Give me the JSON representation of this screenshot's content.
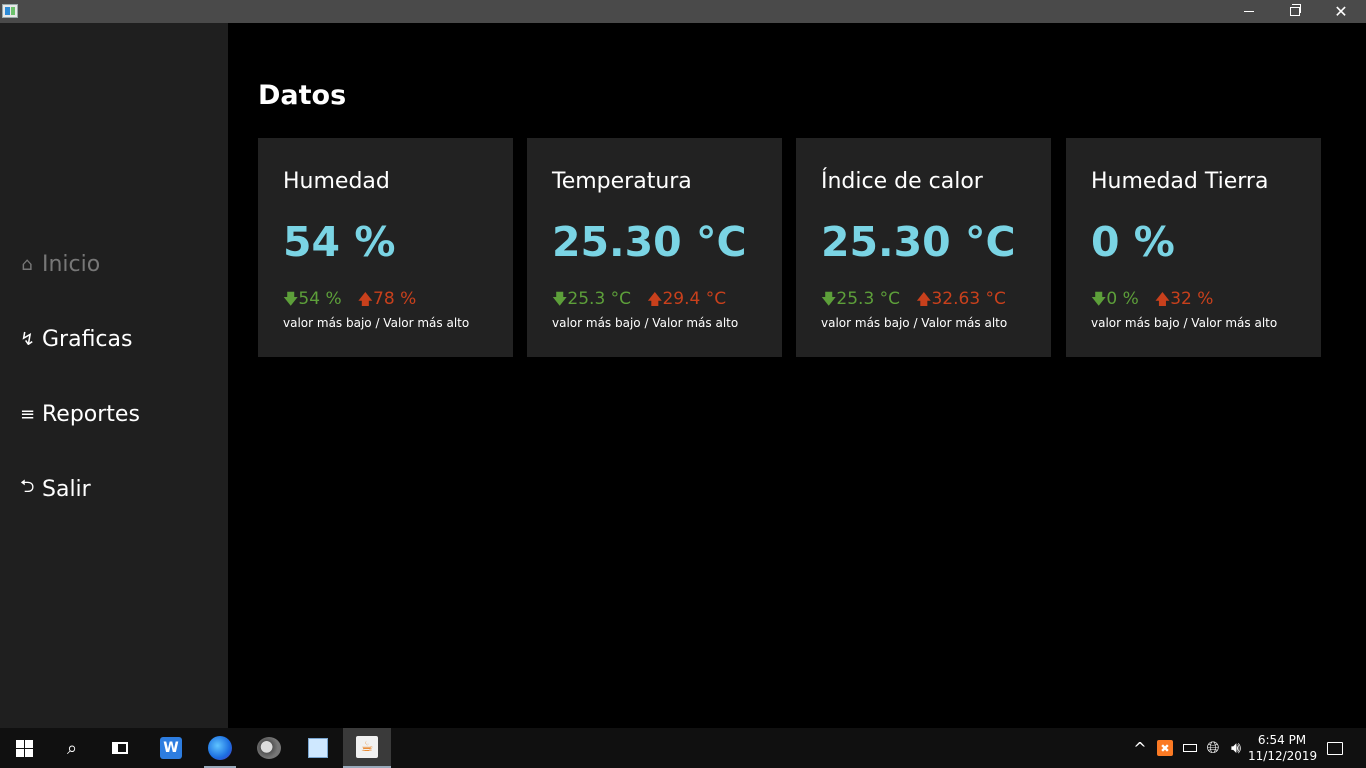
{
  "window": {
    "controls": {
      "minimize": "—",
      "close": "✕"
    }
  },
  "sidebar": {
    "items": [
      {
        "icon": "home-icon",
        "glyph": "⌂",
        "label": "Inicio",
        "state": "disabled"
      },
      {
        "icon": "chart-icon",
        "glyph": "↯",
        "label": "Graficas"
      },
      {
        "icon": "list-icon",
        "glyph": "≡",
        "label": "Reportes"
      },
      {
        "icon": "exit-icon",
        "glyph": "⮌",
        "label": "Salir"
      }
    ]
  },
  "main": {
    "title": "Datos",
    "cards": [
      {
        "title": "Humedad",
        "value": "54 %",
        "low": "54 %",
        "high": "78 %",
        "caption": "valor más bajo / Valor más alto"
      },
      {
        "title": "Temperatura",
        "value": "25.30 °C",
        "low": "25.3 °C",
        "high": "29.4 °C",
        "caption": "valor más bajo / Valor más alto"
      },
      {
        "title": "Índice de calor",
        "value": "25.30 °C",
        "low": "25.3 °C",
        "high": "32.63 °C",
        "caption": "valor más bajo / Valor más alto"
      },
      {
        "title": "Humedad Tierra",
        "value": "0 %",
        "low": "0 %",
        "high": "32 %",
        "caption": "valor más bajo / Valor más alto"
      }
    ],
    "colors": {
      "value": "#7ad4e4",
      "low": "#5d9f3a",
      "high": "#c8401c",
      "card_bg": "#222222"
    }
  },
  "taskbar": {
    "apps": [
      {
        "icon": "windows-start-icon"
      },
      {
        "icon": "search-icon"
      },
      {
        "icon": "task-view-icon"
      },
      {
        "icon": "wps-office-icon",
        "glyph": "W"
      },
      {
        "icon": "firefox-icon"
      },
      {
        "icon": "gimp-icon"
      },
      {
        "icon": "virtualbox-icon"
      },
      {
        "icon": "java-app-icon",
        "glyph": "☕",
        "state": "active"
      }
    ],
    "tray": {
      "chevron": "^",
      "xampp": "✖",
      "time": "6:54 PM",
      "date": "11/12/2019"
    }
  }
}
